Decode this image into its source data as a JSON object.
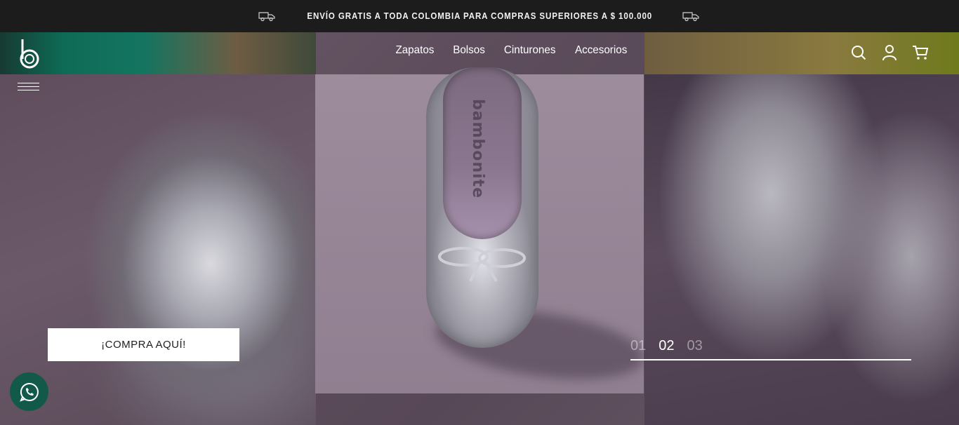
{
  "promo": {
    "text": "ENVÍO GRATIS A TODA COLOMBIA PARA COMPRAS SUPERIORES A $ 100.000",
    "left_icon": "truck-icon",
    "right_icon": "truck-icon"
  },
  "header": {
    "logo_icon": "brand-b-logo",
    "nav": [
      "Zapatos",
      "Bolsos",
      "Cinturones",
      "Accesorios"
    ],
    "icons": [
      "search-icon",
      "user-icon",
      "cart-icon"
    ],
    "menu_icon": "hamburger-menu-icon"
  },
  "hero": {
    "cta_label": "¡COMPRA AQUÍ!",
    "slides": [
      "01",
      "02",
      "03"
    ],
    "active_slide": "02",
    "shoe_brand": "bambonite"
  },
  "whatsapp": {
    "icon": "whatsapp-icon"
  },
  "colors": {
    "promo_bg": "#1c1c1c",
    "hero_bg": "#5e4e5d",
    "whatsapp": "#13594a",
    "cta_bg": "#ffffff"
  }
}
